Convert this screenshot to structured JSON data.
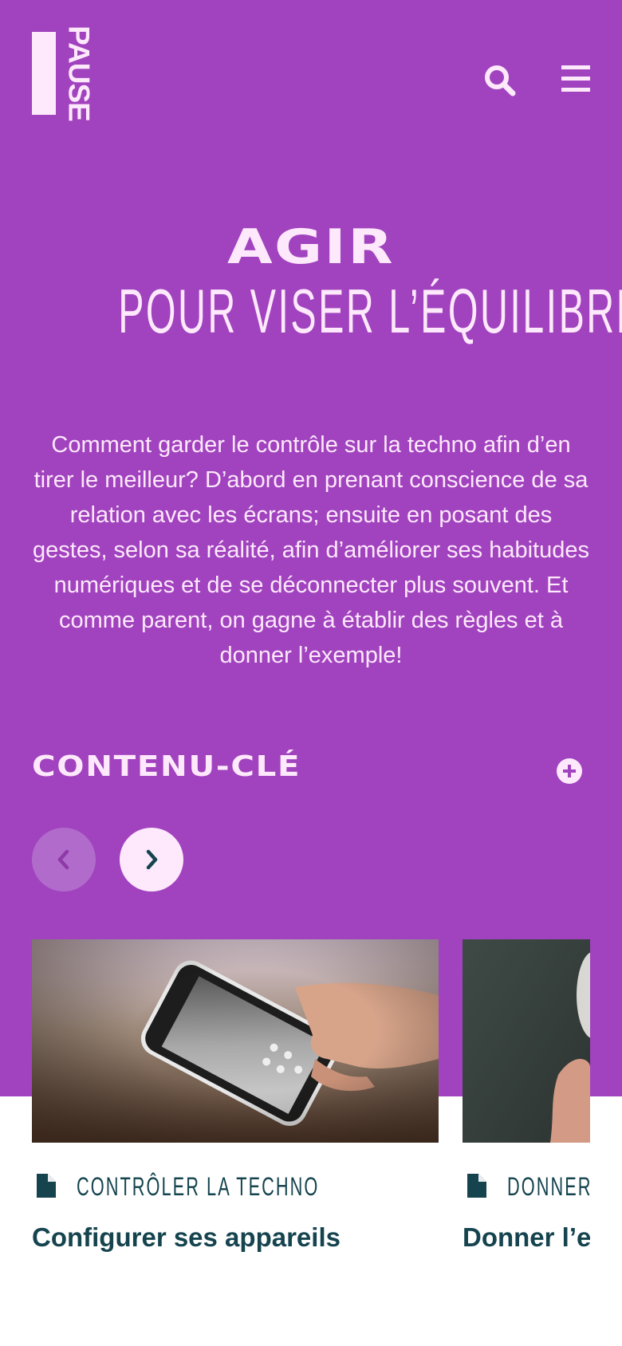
{
  "header": {
    "logo_text": "PAUSE",
    "search_icon": "search-icon",
    "menu_icon": "hamburger-menu-icon"
  },
  "hero": {
    "title_line1": "AGIR",
    "title_line2": "POUR VISER L’ÉQUILIBRE",
    "intro": "Comment garder le contrôle sur la techno afin d’en tirer le meilleur? D’abord en prenant conscience de sa relation avec les écrans; ensuite en posant des gestes, selon sa réalité, afin d’améliorer ses habitudes numériques et de se déconnecter plus souvent. Et comme parent, on gagne à établir des règles et à donner l’exemple!"
  },
  "section": {
    "title": "CONTENU-CLÉ",
    "expand_icon": "plus-circle-icon",
    "prev_icon": "chevron-left-icon",
    "next_icon": "chevron-right-icon"
  },
  "cards": [
    {
      "category": "CONTRÔLER LA TECHNO",
      "title": "Configurer ses appareils",
      "type_icon": "document-icon",
      "image": "hand holding smartphone"
    },
    {
      "category": "DONNER L",
      "title": "Donner l’ex",
      "type_icon": "document-icon",
      "image": "partial photo"
    }
  ],
  "colors": {
    "hero_bg": "#a143bf",
    "light_pink": "#fde9fb",
    "dark_teal": "#15444f",
    "prev_button": "#b16bcb"
  }
}
